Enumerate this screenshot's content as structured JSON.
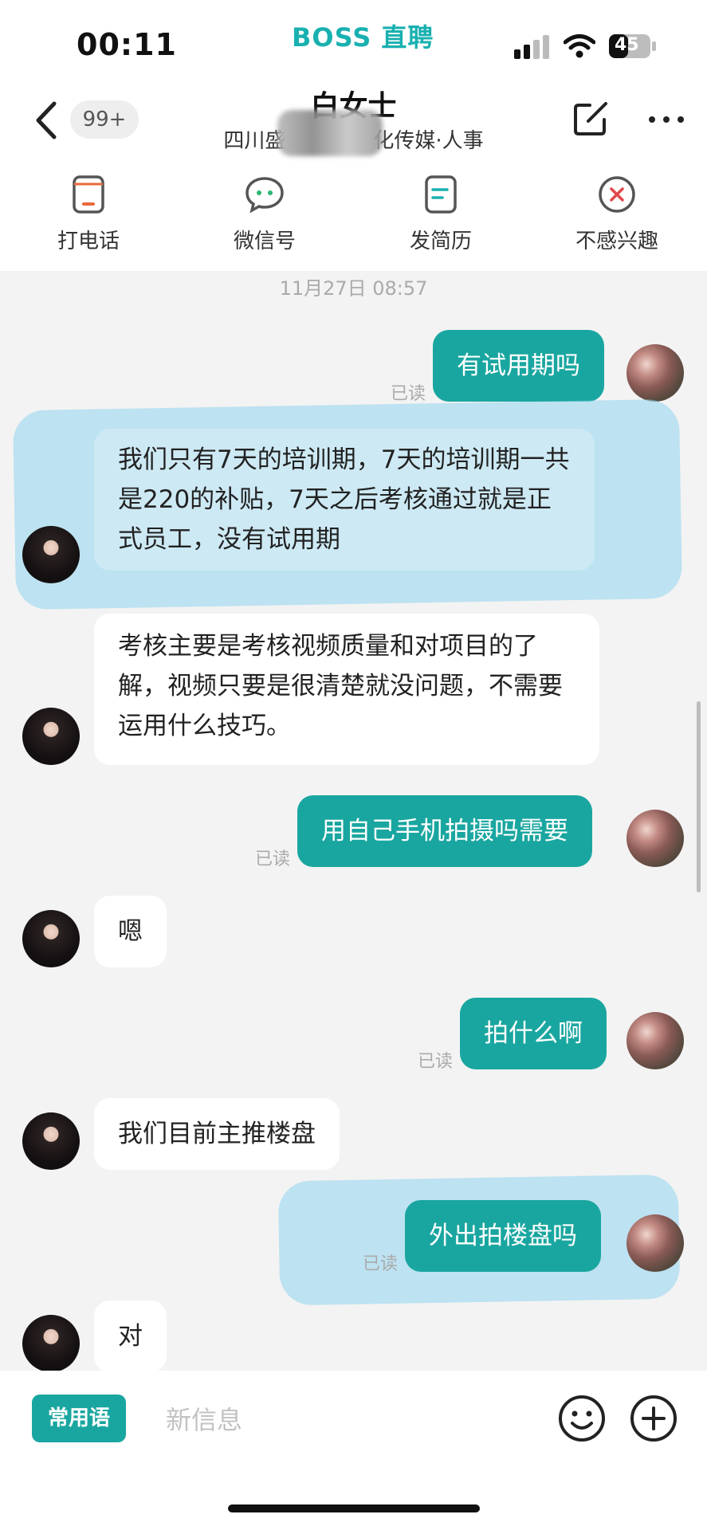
{
  "status": {
    "time": "00:11",
    "brand": "BOSS 直聘",
    "battery": "45"
  },
  "header": {
    "unread_count": "99+",
    "contact_name": "白女士",
    "company_left": "四川盛",
    "company_right": "化传媒·人事"
  },
  "actions": [
    {
      "label": "打电话",
      "icon": "phone-icon"
    },
    {
      "label": "微信号",
      "icon": "wechat-icon"
    },
    {
      "label": "发简历",
      "icon": "resume-icon"
    },
    {
      "label": "不感兴趣",
      "icon": "not-interested-icon"
    }
  ],
  "chat": {
    "timestamp": "11月27日 08:57",
    "read_label": "已读",
    "messages": [
      {
        "from": "me",
        "text": "有试用期吗"
      },
      {
        "from": "her",
        "text": "我们只有7天的培训期，7天的培训期一共是220的补贴，7天之后考核通过就是正式员工，没有试用期"
      },
      {
        "from": "her",
        "text": "考核主要是考核视频质量和对项目的了解，视频只要是很清楚就没问题，不需要运用什么技巧。"
      },
      {
        "from": "me",
        "text": "用自己手机拍摄吗需要"
      },
      {
        "from": "her",
        "text": "嗯"
      },
      {
        "from": "me",
        "text": "拍什么啊"
      },
      {
        "from": "her",
        "text": "我们目前主推楼盘"
      },
      {
        "from": "me",
        "text": "外出拍楼盘吗"
      },
      {
        "from": "her",
        "text": "对"
      }
    ]
  },
  "input": {
    "phrase_button": "常用语",
    "placeholder": "新信息"
  },
  "colors": {
    "accent": "#1aa6a0",
    "brand": "#19b0b0",
    "highlight": "#8fd3ee",
    "danger": "#e0484a"
  }
}
